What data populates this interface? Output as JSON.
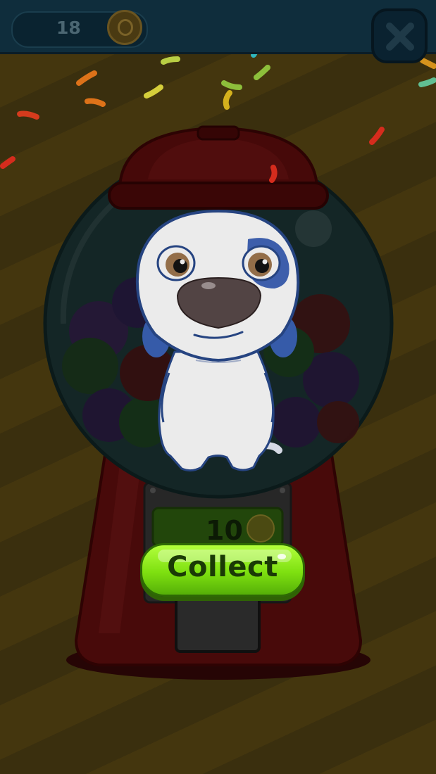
{
  "topbar": {
    "coin_count": "18",
    "coin_icon": "coin-icon",
    "close_icon": "close-icon"
  },
  "machine": {
    "price": "10",
    "price_icon": "coin-icon",
    "collect_label": "Collect"
  },
  "colors": {
    "collect_green": "#7ee010",
    "machine_red": "#4a0a0a",
    "topbar": "#0f2d3c"
  }
}
